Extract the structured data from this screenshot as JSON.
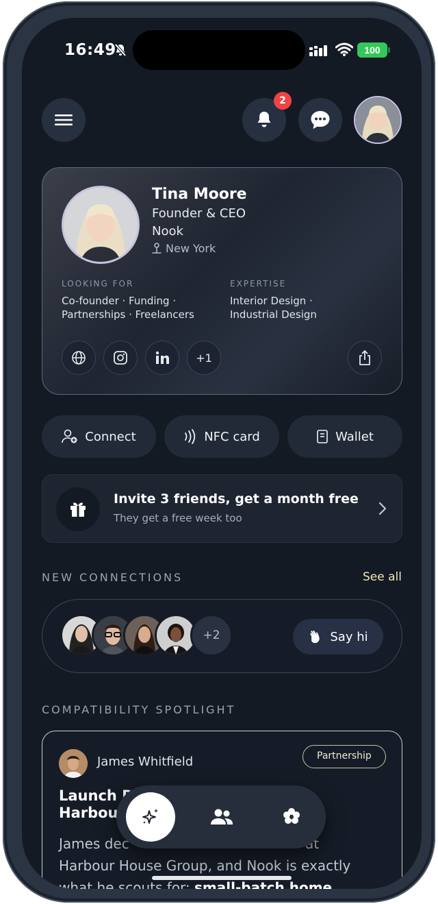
{
  "status": {
    "time": "16:49",
    "battery": "100"
  },
  "header": {
    "notification_count": "2"
  },
  "profile": {
    "name": "Tina Moore",
    "role": "Founder & CEO",
    "company": "Nook",
    "location": "New York",
    "looking_for_label": "LOOKING FOR",
    "looking_for_line1": "Co-founder · Funding ·",
    "looking_for_line2": "Partnerships · Freelancers",
    "expertise_label": "EXPERTISE",
    "expertise_line1": "Interior Design ·",
    "expertise_line2": "Industrial Design",
    "more_links": "+1"
  },
  "actions": {
    "connect": "Connect",
    "nfc": "NFC card",
    "wallet": "Wallet"
  },
  "invite": {
    "title": "Invite 3 friends, get a month free",
    "subtitle": "They get a free week too"
  },
  "new_connections": {
    "title": "NEW CONNECTIONS",
    "see_all": "See all",
    "extra_count": "+2",
    "say_hi": "Say hi"
  },
  "spotlight": {
    "title": "COMPATIBILITY SPOTLIGHT",
    "person": "James Whitfield",
    "tag": "Partnership",
    "heading_line1": "Launch D",
    "heading_line2": "Harbou",
    "body_line1": "James dec",
    "body_line1_end": "at",
    "body_line2": "Harbour House Group, and Nook is exactly",
    "body_line3_a": "what he scouts for:",
    "body_line3_b": "small-batch home"
  },
  "colors": {
    "background": "#141a24",
    "badge": "#ef4444",
    "battery": "#34c759",
    "accent_text": "#f4e6b8"
  }
}
